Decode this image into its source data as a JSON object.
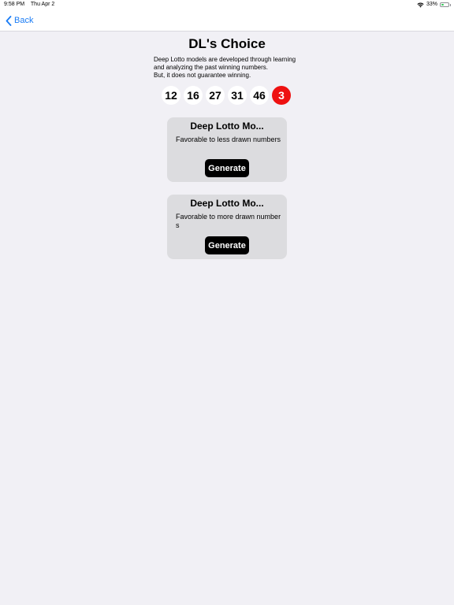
{
  "status": {
    "time": "9:58 PM",
    "date": "Thu Apr 2",
    "battery": "33%",
    "wifi_icon": "wifi-icon",
    "battery_icon": "battery-icon"
  },
  "nav": {
    "back_label": "Back",
    "back_icon": "chevron-left-icon",
    "accent_color": "#1a7cf5"
  },
  "page": {
    "title": "DL's Choice",
    "description_lines": [
      "Deep Lotto models are developed through learning",
      "and analyzing the past winning numbers.",
      "But, it does not guarantee winning."
    ]
  },
  "numbers": [
    "12",
    "16",
    "27",
    "31",
    "46"
  ],
  "bonus_number": "3",
  "bonus_color": "#ee1111",
  "models": [
    {
      "title": "Deep Lotto Mo...",
      "description": "Favorable to less drawn numbers",
      "button_label": "Generate"
    },
    {
      "title": "Deep Lotto Mo...",
      "description": "Favorable to more drawn numbers",
      "button_label": "Generate"
    }
  ]
}
